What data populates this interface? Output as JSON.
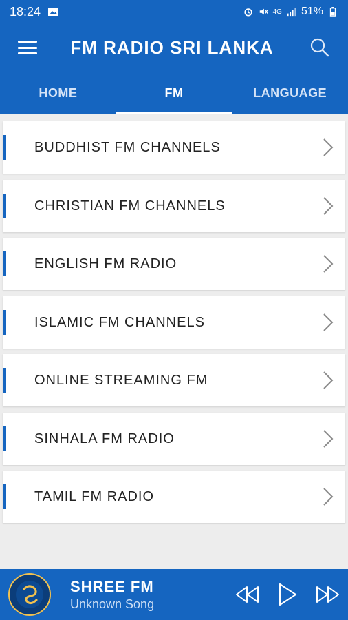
{
  "status_bar": {
    "time": "18:24",
    "battery": "51%",
    "network_label": "4G"
  },
  "app_bar": {
    "title": "FM RADIO SRI LANKA"
  },
  "tabs": [
    {
      "label": "HOME",
      "active": false
    },
    {
      "label": "FM",
      "active": true
    },
    {
      "label": "LANGUAGE",
      "active": false
    }
  ],
  "categories": [
    {
      "label": "BUDDHIST FM CHANNELS"
    },
    {
      "label": "CHRISTIAN FM CHANNELS"
    },
    {
      "label": "ENGLISH FM RADIO"
    },
    {
      "label": "ISLAMIC FM CHANNELS"
    },
    {
      "label": "ONLINE STREAMING FM"
    },
    {
      "label": "SINHALA FM RADIO"
    },
    {
      "label": "TAMIL FM RADIO"
    }
  ],
  "player": {
    "station": "SHREE FM",
    "song": "Unknown Song"
  },
  "colors": {
    "primary": "#1565c0",
    "accent_bar": "#1565c0",
    "logo_gold": "#f2c14e"
  },
  "icons": {
    "menu": "hamburger-icon",
    "search": "search-icon",
    "chevron": "chevron-right-icon",
    "rewind": "rewind-icon",
    "play": "play-icon",
    "forward": "fast-forward-icon"
  }
}
